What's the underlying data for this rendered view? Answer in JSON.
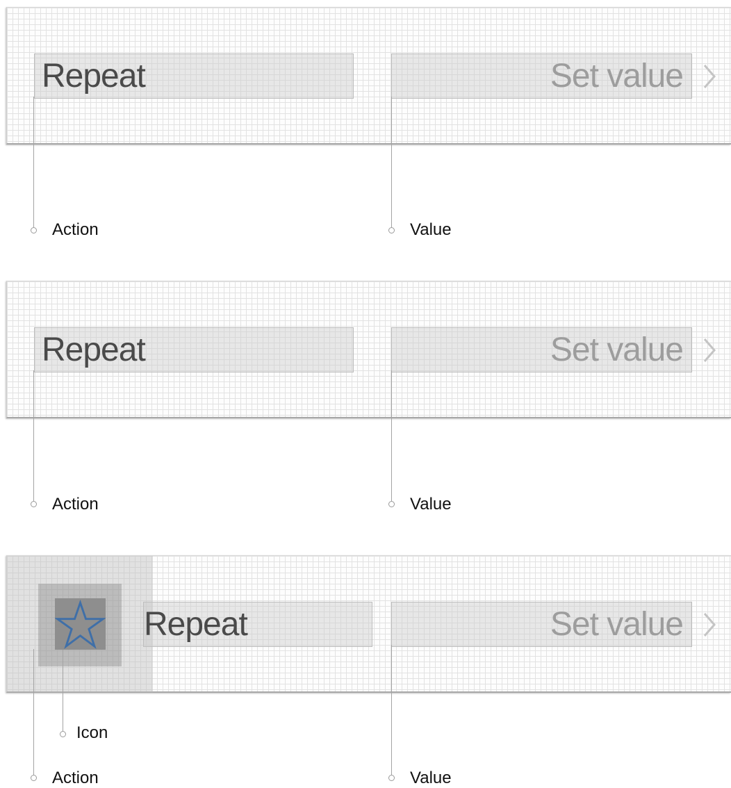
{
  "diagrams": [
    {
      "action_text": "Repeat",
      "value_text": "Set value",
      "labels": {
        "action": "Action",
        "value": "Value"
      }
    },
    {
      "action_text": "Repeat",
      "value_text": "Set value",
      "labels": {
        "action": "Action",
        "value": "Value"
      }
    },
    {
      "action_text": "Repeat",
      "value_text": "Set value",
      "icon": "star-icon",
      "labels": {
        "icon": "Icon",
        "action": "Action",
        "value": "Value"
      }
    }
  ],
  "colors": {
    "grid_line": "#e2e2e2",
    "action_text": "#4a4a4a",
    "value_text": "#9d9d9d",
    "star_outline": "#3f6fa8",
    "leader_line": "#a3a3a3"
  }
}
